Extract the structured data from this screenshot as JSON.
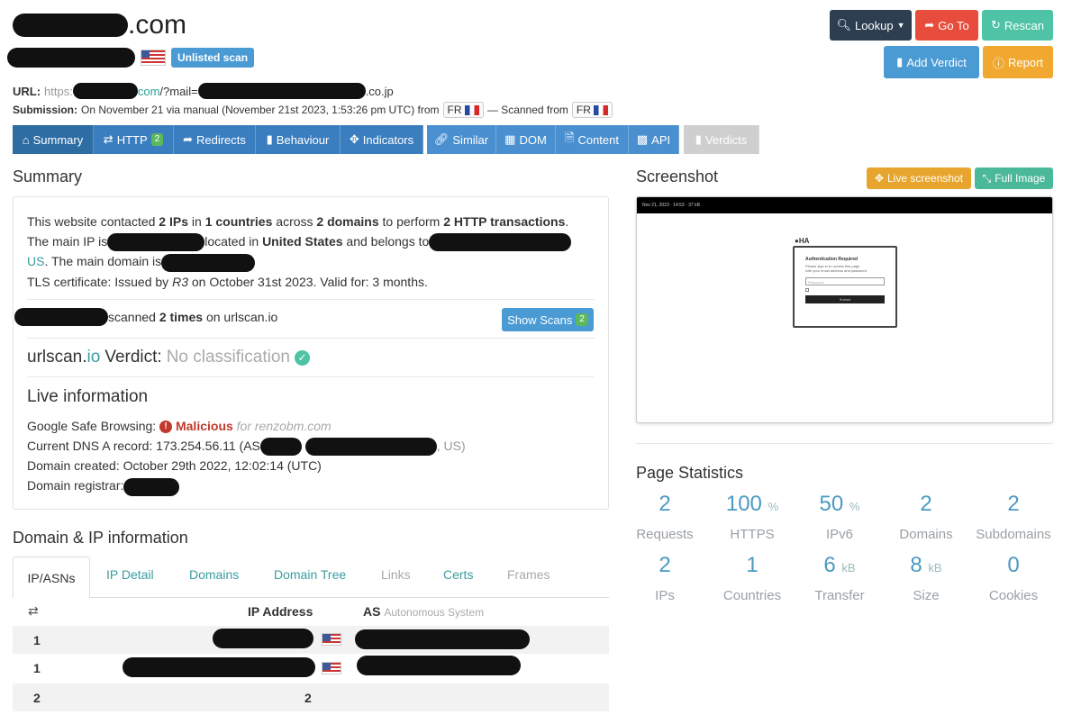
{
  "header": {
    "domain_suffix": ".com",
    "unlisted_label": "Unlisted scan",
    "url_label": "URL:",
    "url_prefix": "https:",
    "url_mid": "com",
    "url_path": "/?mail=",
    "url_tail": ".co.jp",
    "submission_label": "Submission:",
    "submission_text": "On November 21 via manual (November 21st 2023, 1:53:26 pm UTC) from",
    "submission_country": "FR",
    "scanned_from_label": "— Scanned from",
    "scanned_from_country": "FR"
  },
  "actions": {
    "lookup": "Lookup",
    "goto": "Go To",
    "rescan": "Rescan",
    "add_verdict": "Add Verdict",
    "report": "Report"
  },
  "nav": {
    "summary": "Summary",
    "http": "HTTP",
    "http_count": "2",
    "redirects": "Redirects",
    "behaviour": "Behaviour",
    "indicators": "Indicators",
    "similar": "Similar",
    "dom": "DOM",
    "content": "Content",
    "api": "API",
    "verdicts": "Verdicts"
  },
  "summary": {
    "title": "Summary",
    "p1_a": "This website contacted",
    "p1_ips": "2 IPs",
    "p1_b": "in",
    "p1_countries": "1 countries",
    "p1_c": "across",
    "p1_domains": "2 domains",
    "p1_d": "to perform",
    "p1_http": "2 HTTP transactions",
    "p1_e": ".",
    "p2_a": "The main IP is",
    "p2_b": "located in",
    "p2_country": "United States",
    "p2_c": "and belongs to",
    "p3_us": "US",
    "p3_a": ". The main domain is",
    "p4": "TLS certificate: Issued by",
    "p4_issuer": "R3",
    "p4_b": "on October 31st 2023. Valid for: 3 months.",
    "scanned_a": "scanned",
    "scanned_times": "2 times",
    "scanned_b": "on urlscan.io",
    "show_scans": "Show Scans",
    "show_scans_count": "2",
    "verdict_brand_a": "urlscan.",
    "verdict_brand_b": "io",
    "verdict_label": "Verdict:",
    "verdict_value": "No classification",
    "live_title": "Live information",
    "gsb_label": "Google Safe Browsing:",
    "gsb_value": "Malicious",
    "gsb_for": "for renzobm.com",
    "dns_label": "Current DNS A record: 173.254.56.11 (AS",
    "dns_tail": ", US)",
    "created": "Domain created: October 29th 2022, 12:02:14 (UTC)",
    "registrar": "Domain registrar:"
  },
  "screenshot": {
    "title": "Screenshot",
    "live_btn": "Live screenshot",
    "full_btn": "Full Image",
    "topbar_text": "Nov 21, 2023 · 14:53 · 37 kB",
    "logo": "HA",
    "login_title": "Authentication Required",
    "login_line1": "Please sign in to access this page",
    "login_line2": "with your email address and password",
    "login_field": "Password",
    "login_btn": "Submit"
  },
  "stats": {
    "title": "Page Statistics",
    "items": [
      {
        "value": "2",
        "unit": "",
        "label": "Requests"
      },
      {
        "value": "100",
        "unit": "%",
        "label": "HTTPS"
      },
      {
        "value": "50",
        "unit": "%",
        "label": "IPv6"
      },
      {
        "value": "2",
        "unit": "",
        "label": "Domains"
      },
      {
        "value": "2",
        "unit": "",
        "label": "Subdomains"
      },
      {
        "value": "2",
        "unit": "",
        "label": "IPs"
      },
      {
        "value": "1",
        "unit": "",
        "label": "Countries"
      },
      {
        "value": "6",
        "unit": "kB",
        "label": "Transfer"
      },
      {
        "value": "8",
        "unit": "kB",
        "label": "Size"
      },
      {
        "value": "0",
        "unit": "",
        "label": "Cookies"
      }
    ]
  },
  "domain_ip": {
    "title": "Domain & IP information",
    "tabs": [
      "IP/ASNs",
      "IP Detail",
      "Domains",
      "Domain Tree",
      "Links",
      "Certs",
      "Frames"
    ],
    "col_ip": "IP Address",
    "col_as": "AS",
    "col_as_sub": "Autonomous System",
    "rows": [
      {
        "count": "1"
      },
      {
        "count": "1"
      }
    ],
    "total_count": "2",
    "total_ips": "2"
  },
  "colors": {
    "nav_blue": "#3a7ebf",
    "lookup": "#2c3e50",
    "goto": "#e74c3c",
    "rescan": "#4ec3a5",
    "add_verdict": "#4a9ad4",
    "report": "#f0a830",
    "live_btn": "#e7a52e",
    "full_btn": "#4cb89a"
  }
}
